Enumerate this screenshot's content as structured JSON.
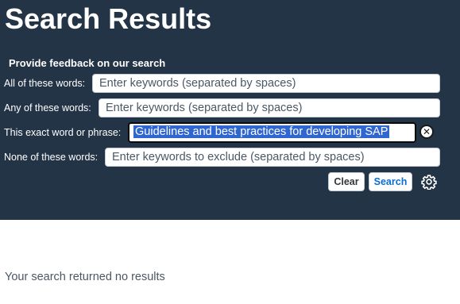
{
  "page": {
    "title": "Search Results"
  },
  "feedback_link": "Provide feedback on our search",
  "form": {
    "all_words": {
      "label": "All of these words:",
      "placeholder": "Enter keywords (separated by spaces)"
    },
    "any_words": {
      "label": "Any of these words:",
      "placeholder": "Enter keywords (separated by spaces)"
    },
    "exact_phrase": {
      "label": "This exact word or phrase:",
      "value": "Guidelines and best practices for developing SAP"
    },
    "none_words": {
      "label": "None of these words:",
      "placeholder": "Enter keywords to exclude (separated by spaces)"
    }
  },
  "buttons": {
    "clear": "Clear",
    "search": "Search"
  },
  "results": {
    "message": "Your search returned no results"
  },
  "icons": {
    "clear_field": "clear-circle-icon",
    "settings": "gear-icon"
  },
  "colors": {
    "header_bg": "#243447",
    "selection": "#2f66d0",
    "search_text": "#0a6ed1"
  }
}
